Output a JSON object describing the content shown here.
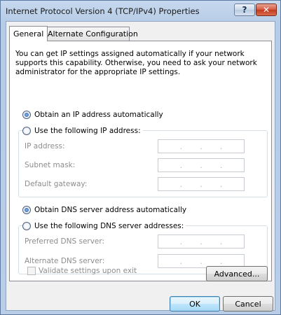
{
  "window": {
    "title": "Internet Protocol Version 4 (TCP/IPv4) Properties",
    "help_label": "?",
    "close_label": "✕"
  },
  "tabs": [
    {
      "label": "General",
      "active": true
    },
    {
      "label": "Alternate Configuration",
      "active": false
    }
  ],
  "intro_text": "You can get IP settings assigned automatically if your network supports this capability. Otherwise, you need to ask your network administrator for the appropriate IP settings.",
  "ip": {
    "auto_label": "Obtain an IP address automatically",
    "auto_selected": true,
    "manual_label": "Use the following IP address:",
    "fields": [
      {
        "label": "IP address:",
        "value": ". . ."
      },
      {
        "label": "Subnet mask:",
        "value": ". . ."
      },
      {
        "label": "Default gateway:",
        "value": ". . ."
      }
    ]
  },
  "dns": {
    "auto_label": "Obtain DNS server address automatically",
    "auto_selected": true,
    "manual_label": "Use the following DNS server addresses:",
    "fields": [
      {
        "label": "Preferred DNS server:",
        "value": ". . ."
      },
      {
        "label": "Alternate DNS server:",
        "value": ". . ."
      }
    ]
  },
  "validate_label": "Validate settings upon exit",
  "buttons": {
    "advanced": "Advanced...",
    "ok": "OK",
    "cancel": "Cancel"
  },
  "colors": {
    "titlebar": "#b9cde7",
    "close_button": "#c23a1e",
    "panel": "#ffffff"
  }
}
